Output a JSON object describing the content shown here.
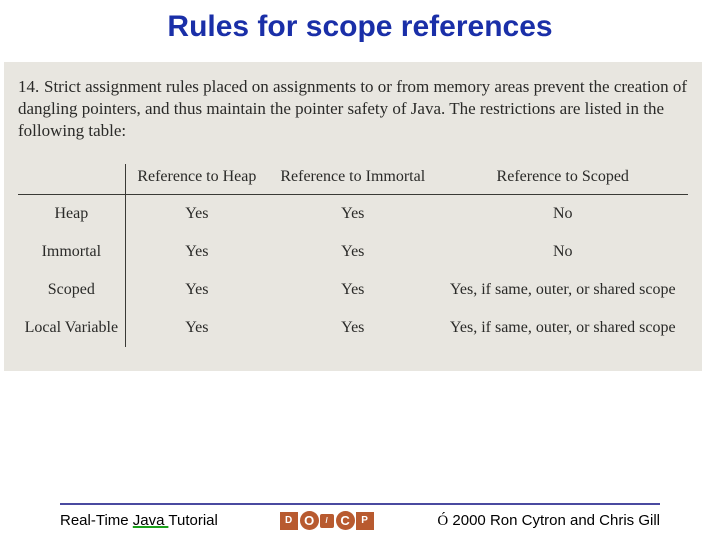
{
  "title": "Rules for scope references",
  "content": {
    "item_number": "14.",
    "paragraph": "Strict assignment rules placed on assignments to or from memory areas prevent the creation of dangling pointers, and thus maintain the pointer safety of Java. The restrictions are listed in the following table:"
  },
  "table": {
    "col_headers": [
      "Reference to Heap",
      "Reference to Immortal",
      "Reference to Scoped"
    ],
    "rows": [
      {
        "label": "Heap",
        "cells": [
          "Yes",
          "Yes",
          "No"
        ]
      },
      {
        "label": "Immortal",
        "cells": [
          "Yes",
          "Yes",
          "No"
        ]
      },
      {
        "label": "Scoped",
        "cells": [
          "Yes",
          "Yes",
          "Yes, if same, outer, or shared scope"
        ]
      },
      {
        "label": "Local Variable",
        "cells": [
          "Yes",
          "Yes",
          "Yes, if same, outer, or shared scope"
        ]
      }
    ]
  },
  "footer": {
    "tutorial_prefix": "Real-Time ",
    "tutorial_link": "Java ",
    "tutorial_suffix": "Tutorial",
    "copyright_symbol": "Ó",
    "copyright_text": " 2000 Ron Cytron and Chris Gill"
  },
  "chart_data": {
    "type": "table",
    "title": "Rules for scope references",
    "row_headers": [
      "Heap",
      "Immortal",
      "Scoped",
      "Local Variable"
    ],
    "col_headers": [
      "Reference to Heap",
      "Reference to Immortal",
      "Reference to Scoped"
    ],
    "values": [
      [
        "Yes",
        "Yes",
        "No"
      ],
      [
        "Yes",
        "Yes",
        "No"
      ],
      [
        "Yes",
        "Yes",
        "Yes, if same, outer, or shared scope"
      ],
      [
        "Yes",
        "Yes",
        "Yes, if same, outer, or shared scope"
      ]
    ]
  }
}
